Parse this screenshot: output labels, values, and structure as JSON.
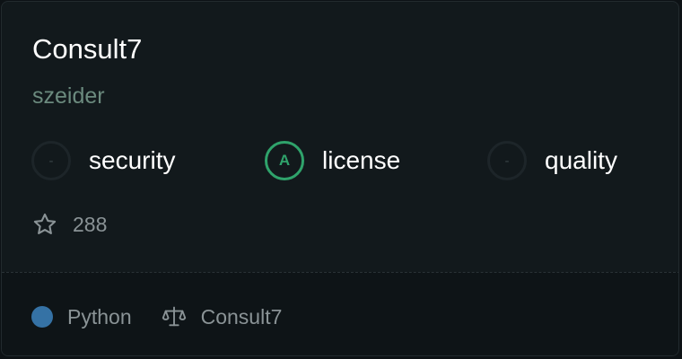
{
  "repo": {
    "name": "Consult7",
    "owner": "szeider"
  },
  "scores": [
    {
      "grade": "-",
      "label": "security",
      "state": "ungraded"
    },
    {
      "grade": "A",
      "label": "license",
      "state": "graded",
      "color": "#2fa36b"
    },
    {
      "grade": "-",
      "label": "quality",
      "state": "ungraded"
    }
  ],
  "stars": {
    "icon": "star-icon",
    "count": "288"
  },
  "footer": {
    "language": "Python",
    "language_color": "#3572a5",
    "license_icon": "scale-icon",
    "license": "Consult7"
  }
}
